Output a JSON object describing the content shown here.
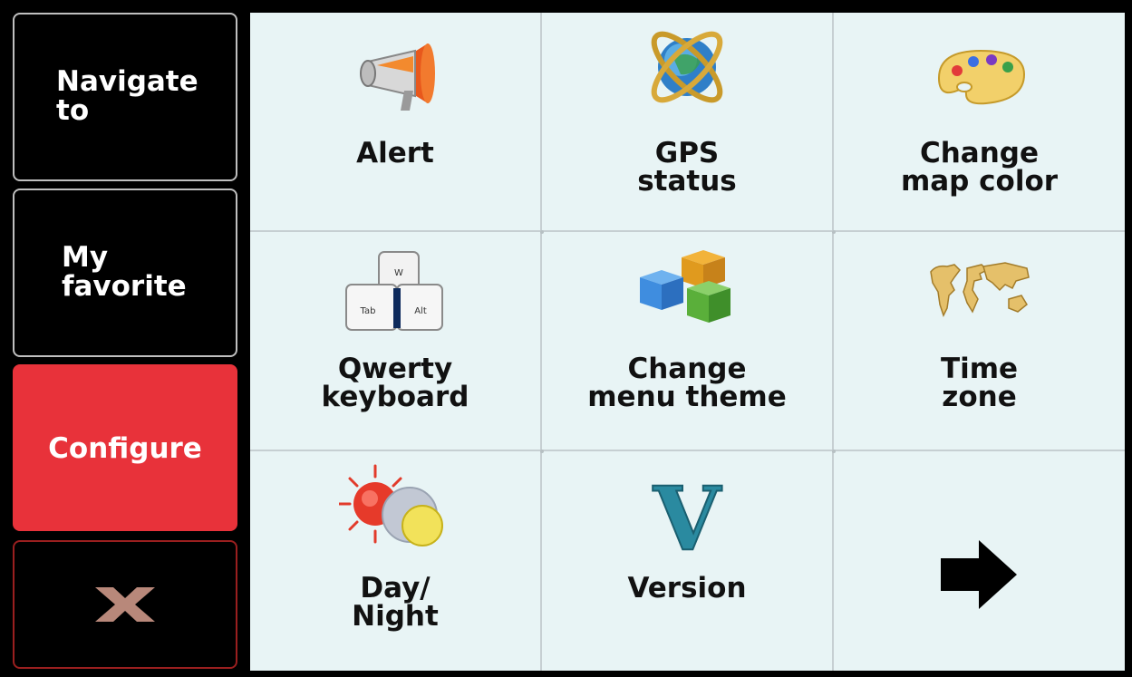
{
  "sidebar": {
    "navigate_label": "Navigate\nto",
    "favorite_label": "My\nfavorite",
    "configure_label": "Configure",
    "close_icon": "close-x-icon",
    "active_color": "#e8323a"
  },
  "menu": {
    "items": [
      {
        "label": "Alert",
        "icon": "megaphone-icon"
      },
      {
        "label": "GPS\nstatus",
        "icon": "globe-orbit-icon"
      },
      {
        "label": "Change\nmap color",
        "icon": "palette-icon"
      },
      {
        "label": "Qwerty\nkeyboard",
        "icon": "keyboard-keys-icon",
        "key_labels": [
          "W",
          "Tab",
          "Alt"
        ]
      },
      {
        "label": "Change\nmenu theme",
        "icon": "cubes-icon"
      },
      {
        "label": "Time\nzone",
        "icon": "world-map-icon"
      },
      {
        "label": "Day/\nNight",
        "icon": "sun-moon-icon"
      },
      {
        "label": "Version",
        "icon": "letter-v-icon",
        "glyph": "V"
      },
      {
        "label": "",
        "icon": "next-arrow-icon"
      }
    ]
  }
}
